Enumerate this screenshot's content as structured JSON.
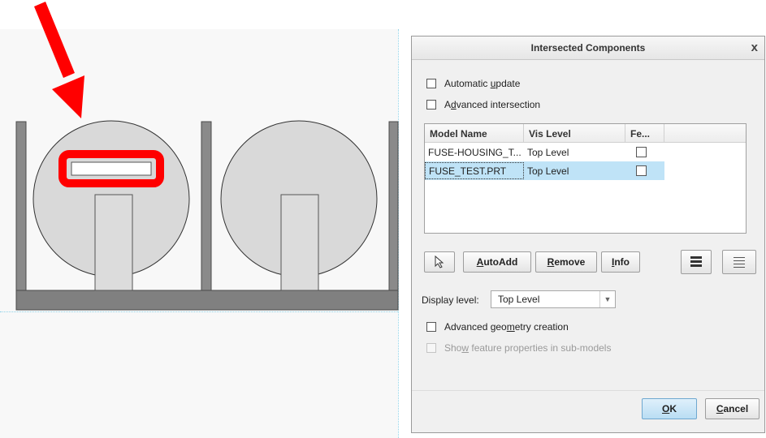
{
  "dialog": {
    "title": "Intersected Components",
    "close_glyph": "x",
    "automatic_update": {
      "pre": "Automatic ",
      "u": "u",
      "post": "pdate"
    },
    "advanced_intersection": {
      "pre": "A",
      "u": "d",
      "post": "vanced intersection"
    },
    "table": {
      "headers": [
        "Model Name",
        "Vis Level",
        "Fe..."
      ],
      "rows": [
        {
          "model": "FUSE-HOUSING_T...",
          "vis": "Top Level",
          "checked": false,
          "selected": false
        },
        {
          "model": "FUSE_TEST.PRT",
          "vis": "Top Level",
          "checked": false,
          "selected": true
        }
      ]
    },
    "buttons": {
      "autoadd": {
        "u": "A",
        "post": "utoAdd"
      },
      "remove": {
        "u": "R",
        "post": "emove"
      },
      "info": {
        "u": "I",
        "post": "nfo"
      },
      "ok": {
        "u": "O",
        "post": "K"
      },
      "cancel": {
        "u": "C",
        "post": "ancel"
      }
    },
    "display_level": {
      "label": "Display level:",
      "value": "Top Level"
    },
    "advanced_geometry": {
      "pre": "Advanced geo",
      "u": "m",
      "post": "etry creation"
    },
    "show_feature": {
      "pre": "Sho",
      "u": "w",
      "post": " feature properties in sub-models"
    }
  },
  "colors": {
    "arrow": "#ff0000",
    "highlight_box": "#ff0000",
    "part_fill": "#d9d9d9",
    "base_fill": "#808080",
    "selected_row": "#bfe3f7"
  }
}
